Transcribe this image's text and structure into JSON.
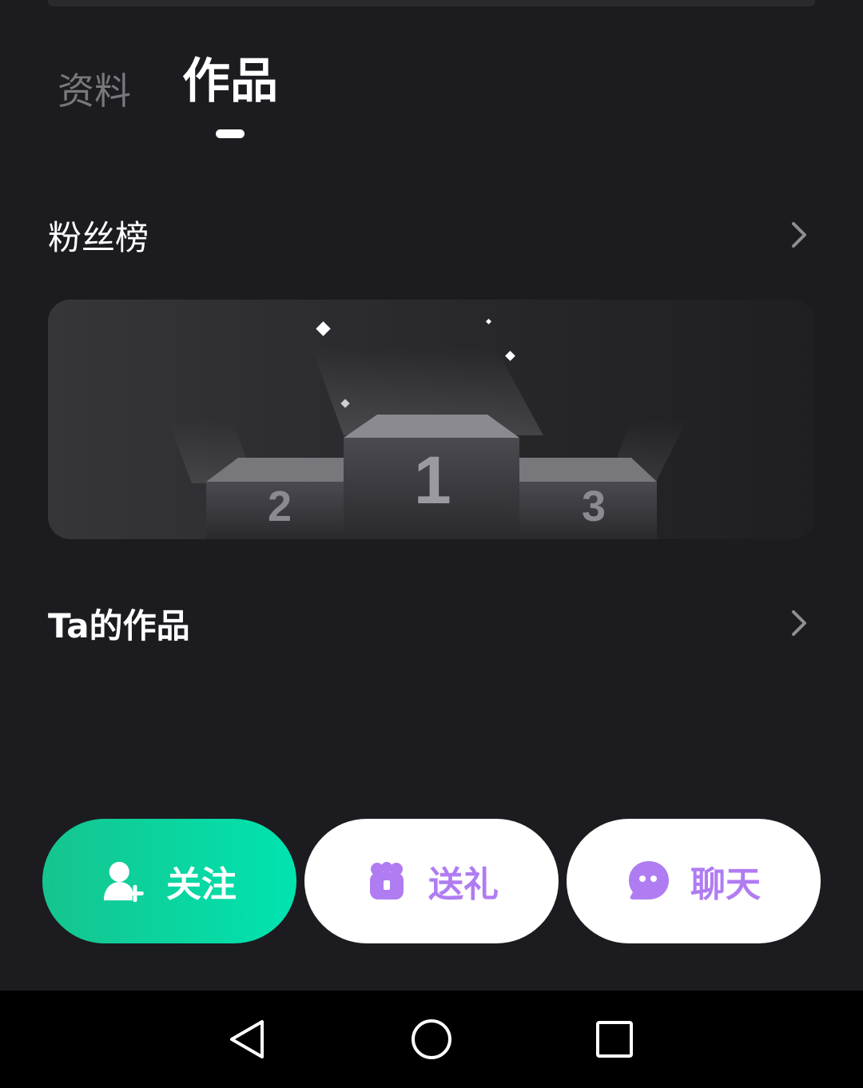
{
  "tabs": [
    {
      "label": "资料",
      "active": false
    },
    {
      "label": "作品",
      "active": true
    }
  ],
  "sections": {
    "fans_rank": {
      "title": "粉丝榜"
    },
    "works": {
      "title": "Ta的作品"
    }
  },
  "podium": {
    "first": "1",
    "second": "2",
    "third": "3"
  },
  "actions": {
    "follow": {
      "label": "关注",
      "icon": "add-user-icon"
    },
    "gift": {
      "label": "送礼",
      "icon": "gift-icon"
    },
    "chat": {
      "label": "聊天",
      "icon": "chat-bubble-icon"
    }
  },
  "colors": {
    "background": "#1c1c20",
    "follow_accent": "#00e4b0",
    "gift_chat_accent": "#b07cf2"
  },
  "system_nav": {
    "back": "back-icon",
    "home": "home-icon",
    "recent": "recent-apps-icon"
  }
}
